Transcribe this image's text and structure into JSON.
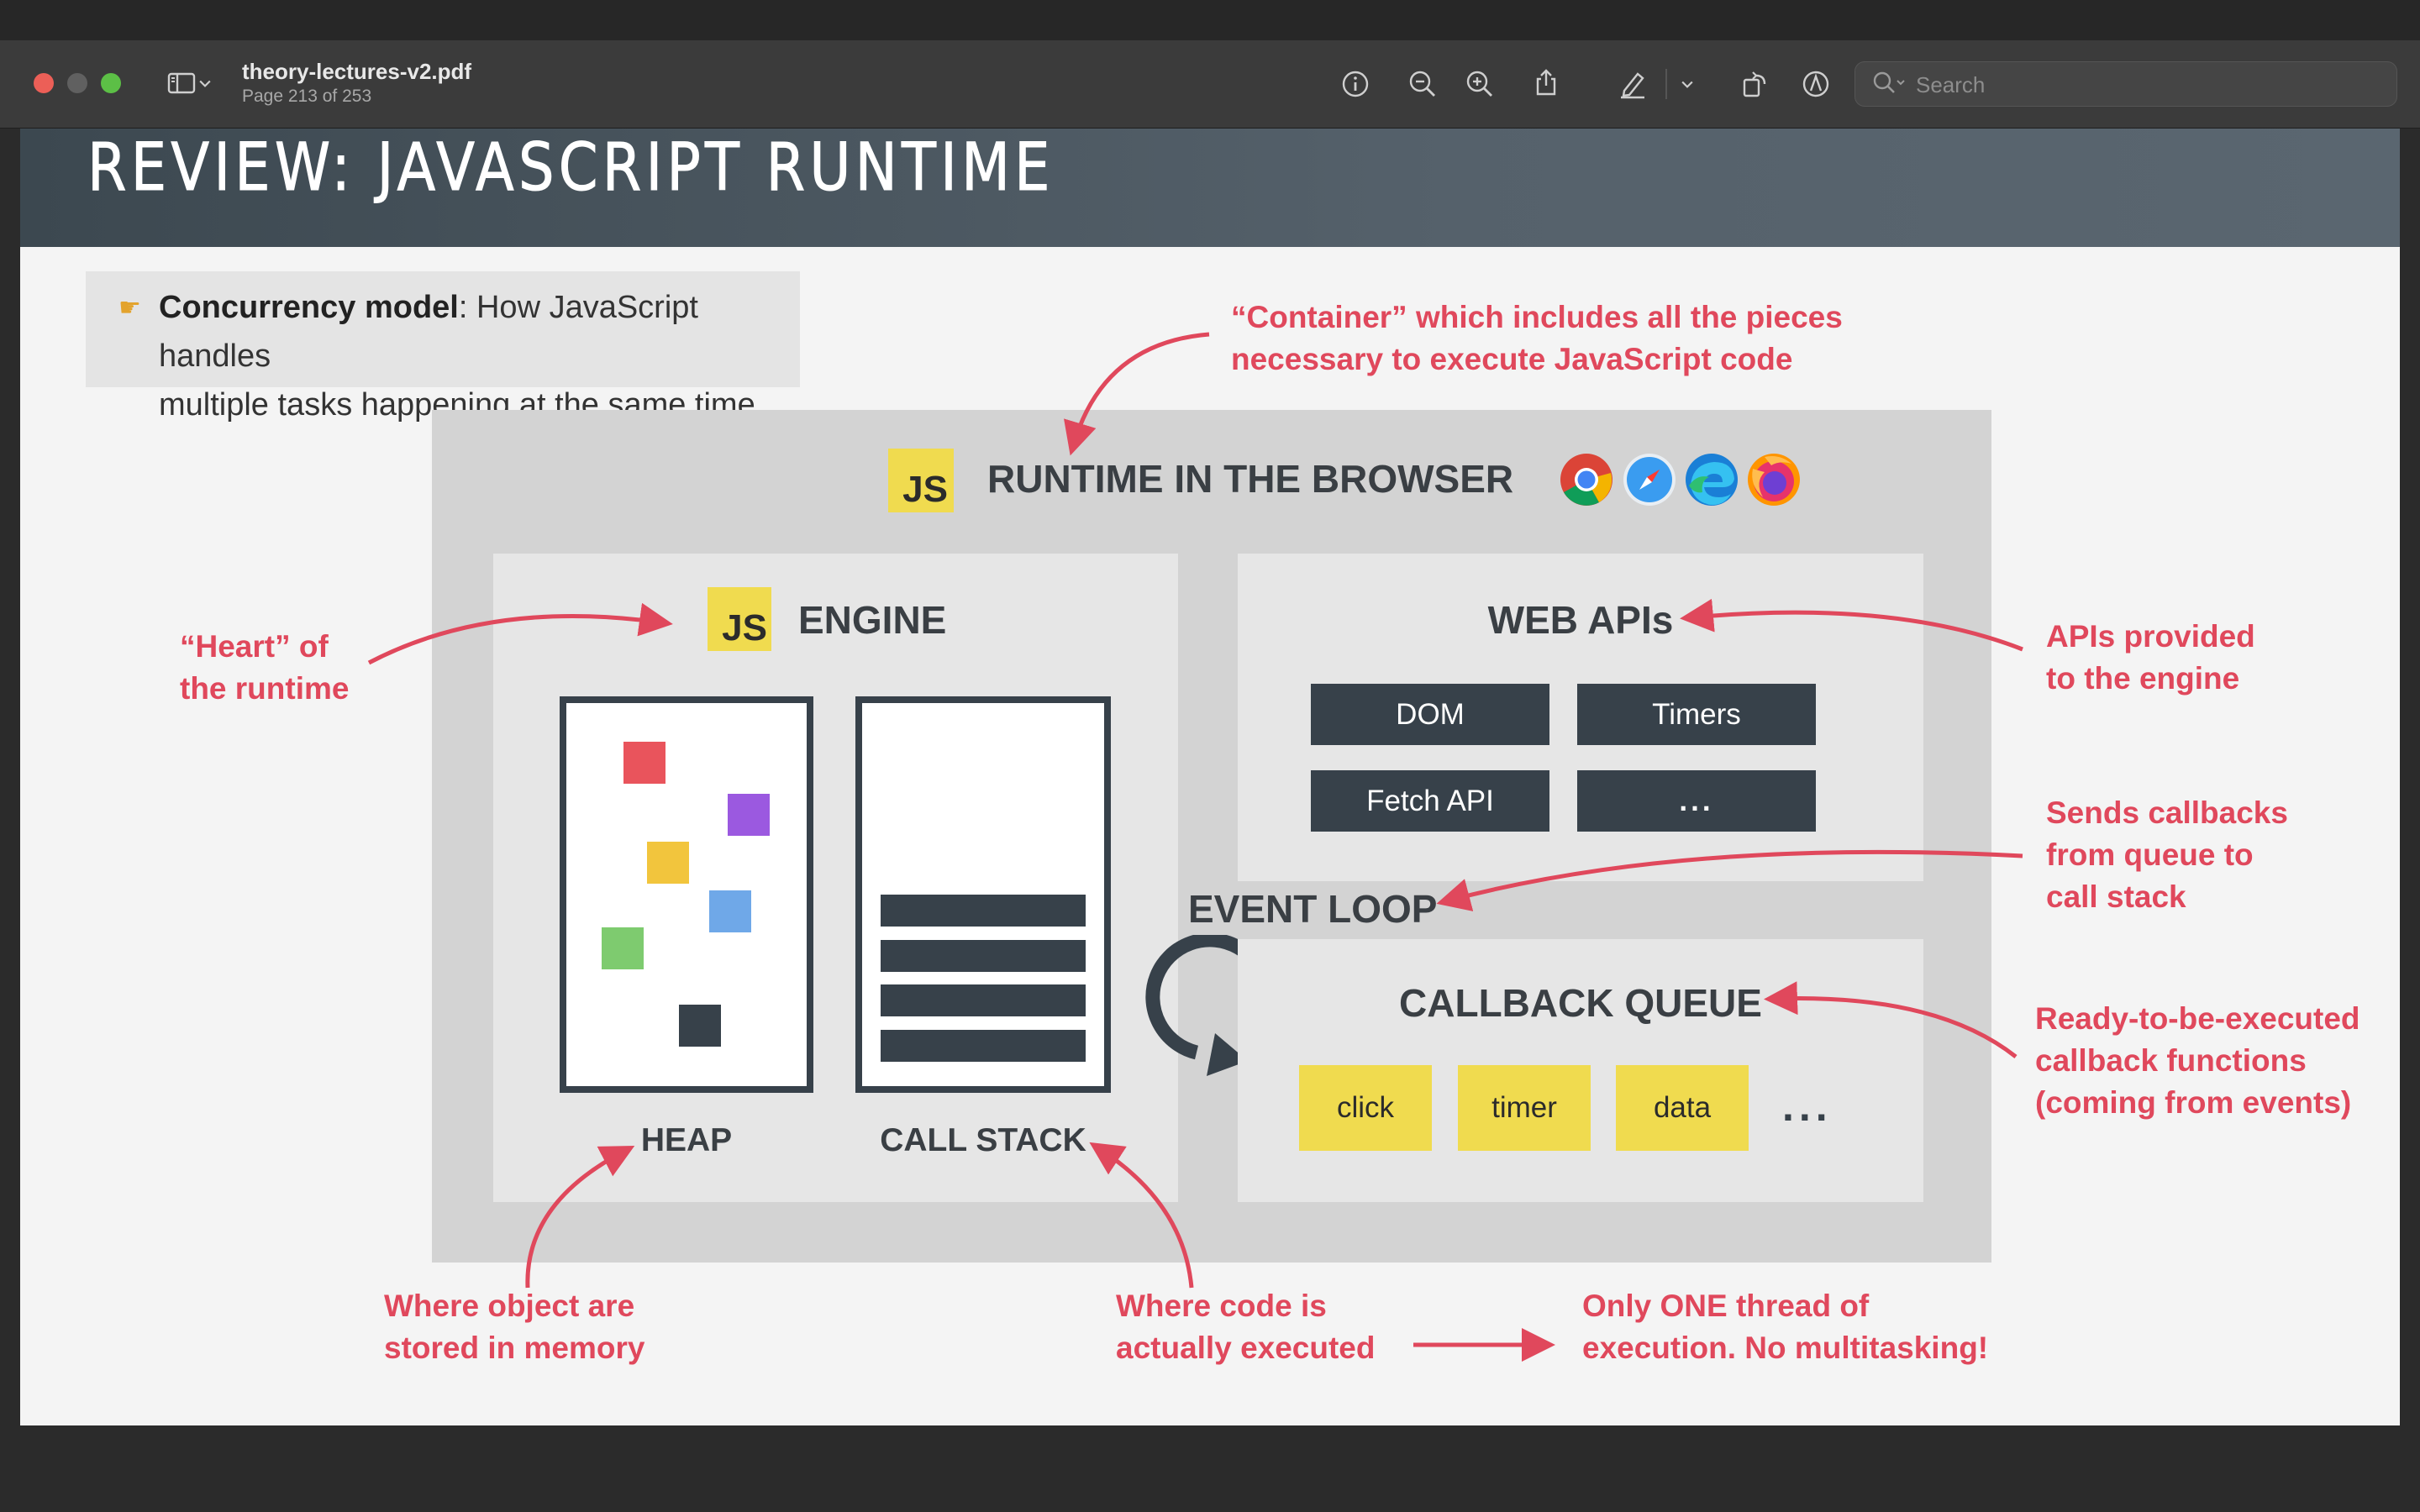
{
  "window": {
    "file_name": "theory-lectures-v2.pdf",
    "page_info": "Page 213 of 253",
    "search_placeholder": "Search",
    "traffic_lights": {
      "close": "#ec5f57",
      "minimize": "#606060",
      "zoom": "#5cbf46"
    }
  },
  "toolbar": {
    "icons": [
      "sidebar-icon",
      "chevron-down-icon",
      "info-icon",
      "zoom-out-icon",
      "zoom-in-icon",
      "share-icon",
      "highlight-pen-icon",
      "chevron-down-icon",
      "rotate-icon",
      "markup-icon",
      "search-icon"
    ]
  },
  "slide": {
    "title": "REVIEW: JAVASCRIPT RUNTIME",
    "concurrency": {
      "term": "Concurrency model",
      "rest_line1": ": How JavaScript handles",
      "line2": "multiple tasks happening at the same time."
    },
    "runtime": {
      "js_badge": "JS",
      "title": "RUNTIME IN THE BROWSER",
      "browser_icons": [
        "chrome-icon",
        "safari-icon",
        "edge-icon",
        "firefox-icon"
      ]
    },
    "engine": {
      "js_badge": "JS",
      "title": "ENGINE",
      "heap_label": "HEAP",
      "stack_label": "CALL STACK",
      "heap_colors": [
        "#e9545c",
        "#9b59e0",
        "#f2c53d",
        "#6fa8e8",
        "#7ecb6f",
        "#37414a"
      ]
    },
    "web_apis": {
      "title": "WEB APIs",
      "items": [
        "DOM",
        "Timers",
        "Fetch API",
        "..."
      ]
    },
    "event_loop": "EVENT LOOP",
    "callback_queue": {
      "title": "CALLBACK QUEUE",
      "items": [
        "click",
        "timer",
        "data"
      ],
      "more": "..."
    },
    "annotations": {
      "container_line1": "“Container” which includes all the pieces",
      "container_line2": "necessary to execute JavaScript code",
      "heart_line1": "“Heart” of",
      "heart_line2": "the runtime",
      "apis_line1": "APIs provided",
      "apis_line2": "to the engine",
      "sends_line1": "Sends callbacks",
      "sends_line2": "from queue to",
      "sends_line3": "call stack",
      "ready_line1": "Ready-to-be-executed",
      "ready_line2": "callback functions",
      "ready_line3": "(coming from events)",
      "heap_line1": "Where object are",
      "heap_line2": "stored in memory",
      "stack_line1": "Where code is",
      "stack_line2": "actually executed",
      "thread_line1": "Only ONE thread of",
      "thread_line2": "execution. No multitasking!"
    },
    "colors": {
      "accent_red": "#e0485c",
      "js_yellow": "#f0db4f",
      "dark": "#37414a"
    }
  }
}
